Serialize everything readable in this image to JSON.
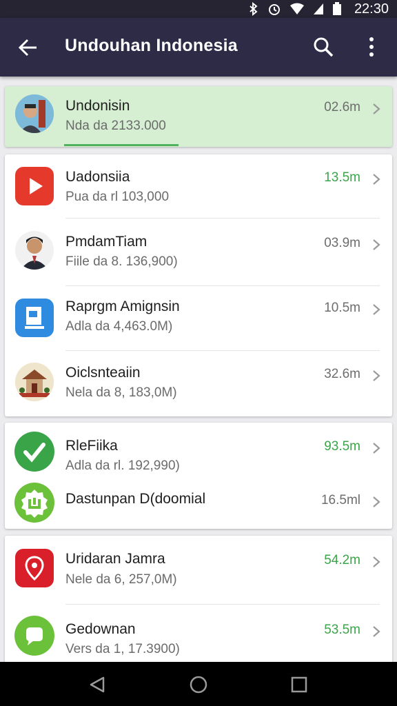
{
  "status_bar": {
    "time": "22:30",
    "icons": [
      "bluetooth-icon",
      "alarm-icon",
      "wifi-icon",
      "signal-icon",
      "battery-icon"
    ]
  },
  "app_bar": {
    "title": "Undouhan Indonesia",
    "icons": [
      "back-arrow-icon",
      "search-icon",
      "more-vert-icon"
    ]
  },
  "accent_green": "#3aa548",
  "lists": {
    "active": {
      "name": "Undonisin",
      "sub": "Nda da 2133.000",
      "size": "02.6m",
      "progress": 0.36,
      "icon": "avatar-photo-icon"
    },
    "group1": [
      {
        "name": "Uadonsiia",
        "sub": "Pua da rl 103,000",
        "size": "13.5m",
        "size_green": true,
        "icon": "youtube-play-icon"
      },
      {
        "name": "PmdamTiam",
        "sub": "Fiile da 8. 136,900)",
        "size": "03.9m",
        "size_green": false,
        "icon": "person-photo-icon"
      },
      {
        "name": "Raprgm Amignsin",
        "sub": "Adla da 4,463.0M)",
        "size": "10.5m",
        "size_green": false,
        "icon": "document-app-icon"
      },
      {
        "name": "Oiclsnteaiin",
        "sub": "Nela da 8, 183,0M)",
        "size": "32.6m",
        "size_green": false,
        "icon": "temple-illustration-icon"
      }
    ],
    "group2": [
      {
        "name": "RleFiika",
        "sub": "Adla da rl. 192,990)",
        "size": "93.5m",
        "size_green": true,
        "icon": "checkmark-app-icon"
      },
      {
        "name": "Dastunpan D(doomial",
        "sub": "",
        "size": "16.5ml",
        "size_green": false,
        "icon": "badge-app-icon"
      }
    ],
    "group3": [
      {
        "name": "Uridaran Jamra",
        "sub": "Nele da 6, 257,0M)",
        "size": "54.2m",
        "size_green": true,
        "icon": "location-pin-app-icon"
      },
      {
        "name": "Gedownan",
        "sub": "Vers da 1, 17.3900)",
        "size": "53.5m",
        "size_green": true,
        "icon": "chat-bubble-app-icon"
      }
    ]
  },
  "nav_bar": {
    "icons": [
      "nav-back-icon",
      "nav-home-icon",
      "nav-recents-icon"
    ]
  }
}
